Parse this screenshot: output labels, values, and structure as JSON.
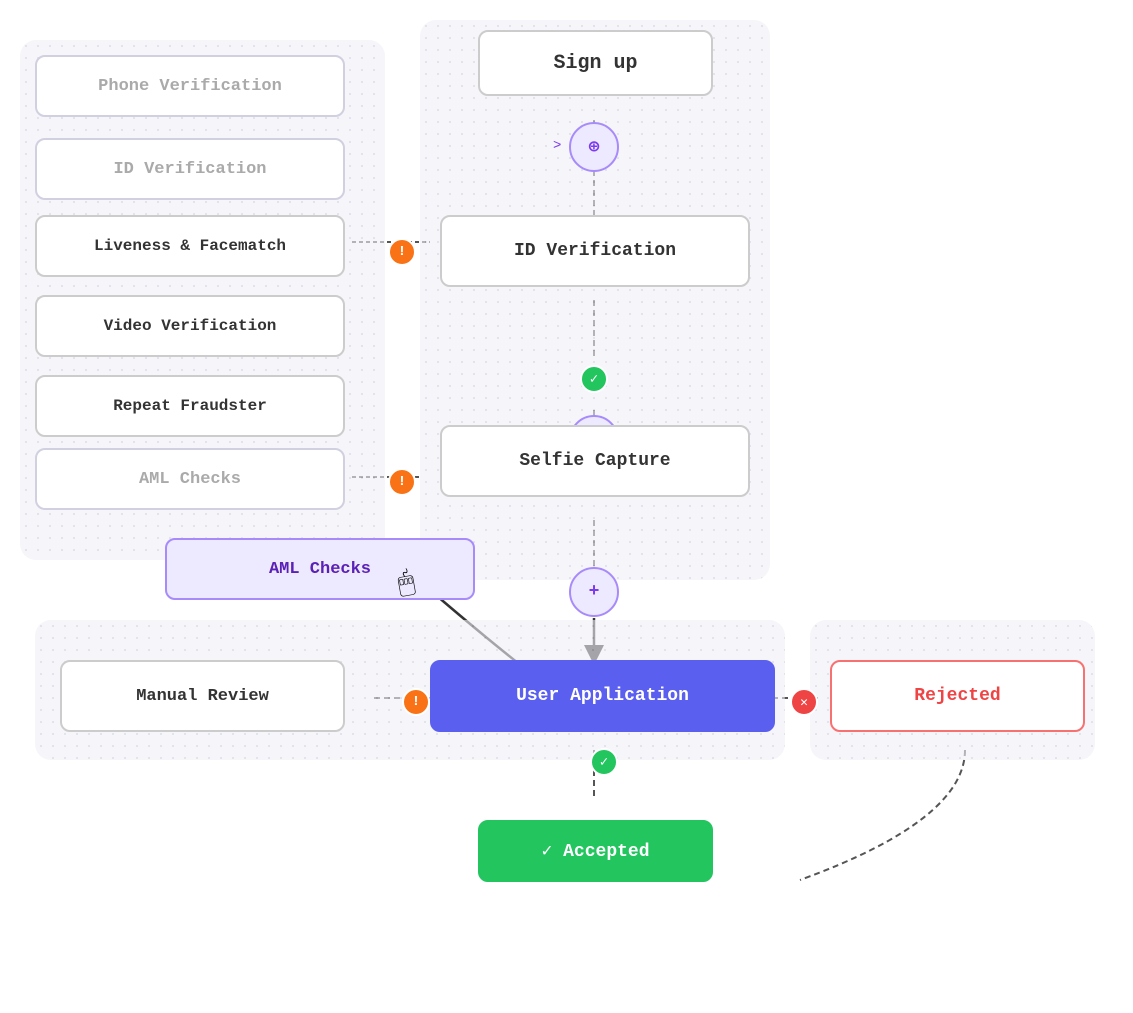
{
  "nodes": {
    "signup": {
      "label": "Sign up"
    },
    "id_verification_main": {
      "label": "ID Verification"
    },
    "selfie_capture": {
      "label": "Selfie Capture"
    },
    "user_application": {
      "label": "User Application"
    },
    "accepted": {
      "label": "✓  Accepted"
    },
    "rejected": {
      "label": "Rejected"
    },
    "manual_review": {
      "label": "Manual Review"
    },
    "phone_verification": {
      "label": "Phone Verification"
    },
    "id_verification_side": {
      "label": "ID Verification"
    },
    "liveness": {
      "label": "Liveness & Facematch"
    },
    "video": {
      "label": "Video Verification"
    },
    "repeat_fraudster": {
      "label": "Repeat Fraudster"
    },
    "aml_checks_side": {
      "label": "AML Checks"
    },
    "aml_checks_dragging": {
      "label": "AML Checks"
    }
  },
  "badges": {
    "warn": "!",
    "check": "✓",
    "cross": "✕"
  },
  "icons": {
    "plus": "+",
    "crosshair": "⊕",
    "cursor": "↖"
  },
  "colors": {
    "accent": "#5b5fef",
    "green": "#22c55e",
    "red": "#ef4444",
    "orange": "#f97316",
    "purple_light": "#ede9fe",
    "purple_border": "#a78bfa"
  }
}
